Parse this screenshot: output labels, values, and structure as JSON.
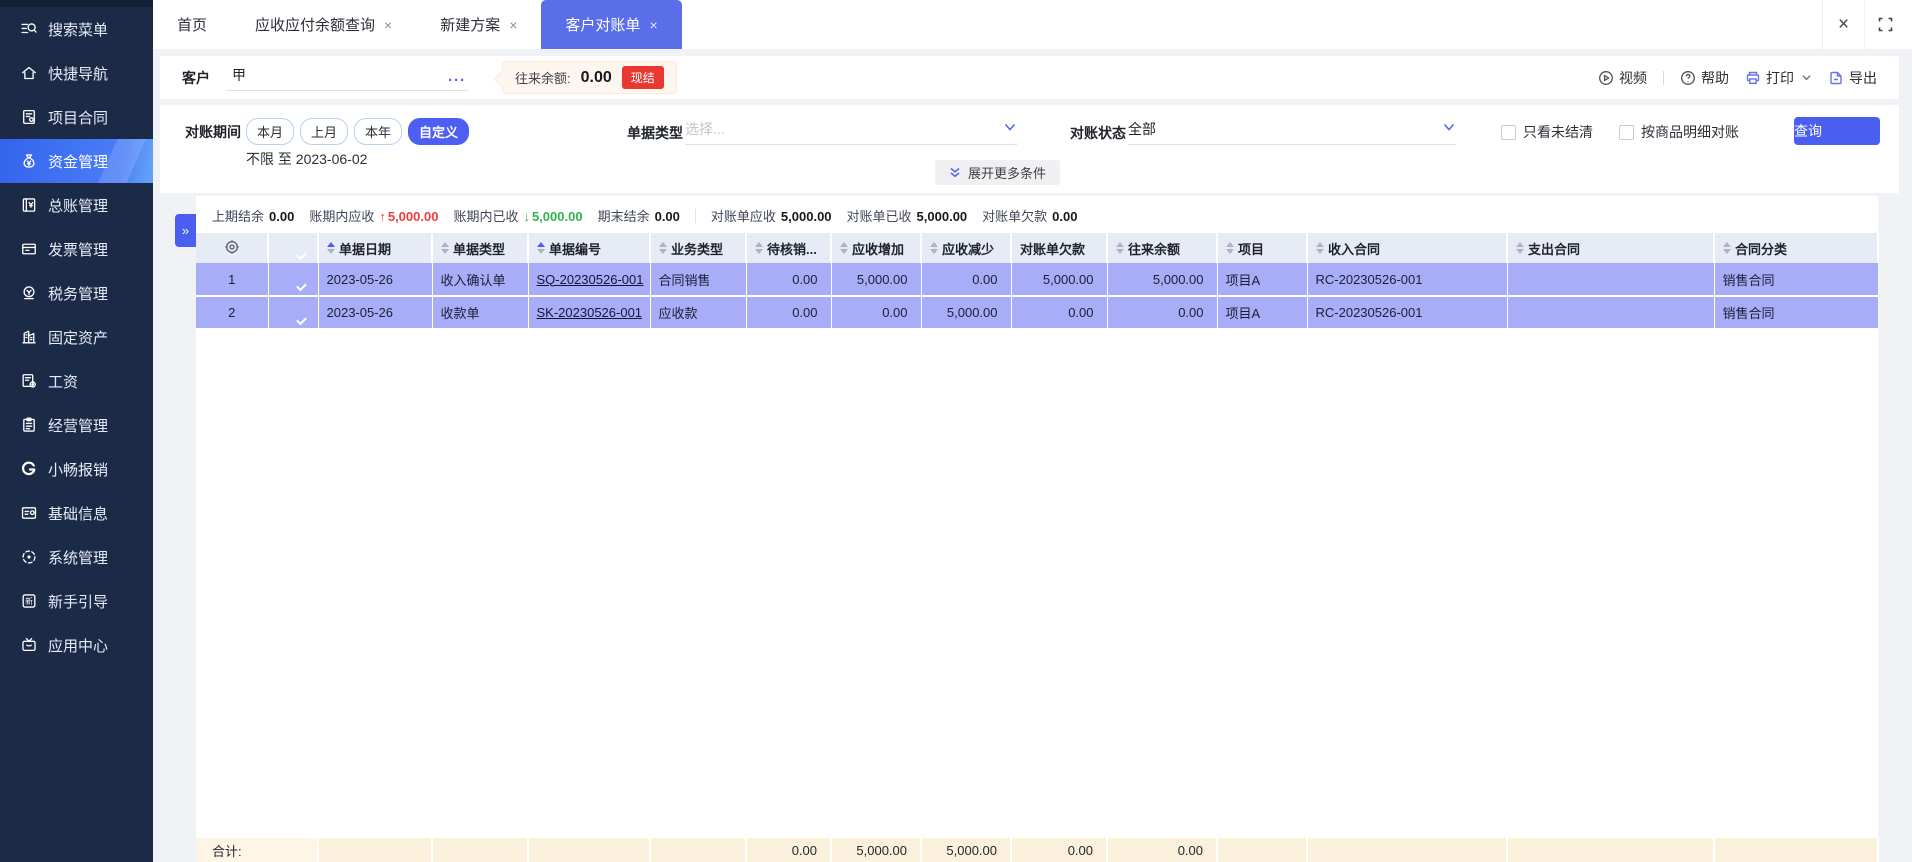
{
  "colors": {
    "accent": "#4d5ef2",
    "tab_active": "#5a6ee8",
    "sidebar_bg": "#1b2a47",
    "row_highlight": "#a8adf7",
    "table_header_bg": "#e7ebf6",
    "totals_bg": "#fbf0dc",
    "red": "#e8382f",
    "green": "#2fb54d",
    "page_bg": "#f0f2f5"
  },
  "sidebar": {
    "items": [
      {
        "label": "搜索菜单",
        "icon": "search-menu-icon"
      },
      {
        "label": "快捷导航",
        "icon": "home-icon"
      },
      {
        "label": "项目合同",
        "icon": "project-contract-icon"
      },
      {
        "label": "资金管理",
        "icon": "money-bag-icon",
        "active": true
      },
      {
        "label": "总账管理",
        "icon": "ledger-icon"
      },
      {
        "label": "发票管理",
        "icon": "invoice-icon"
      },
      {
        "label": "税务管理",
        "icon": "tax-icon"
      },
      {
        "label": "固定资产",
        "icon": "building-icon"
      },
      {
        "label": "工资",
        "icon": "salary-icon"
      },
      {
        "label": "经营管理",
        "icon": "clipboard-icon"
      },
      {
        "label": "小畅报销",
        "icon": "g-logo-icon"
      },
      {
        "label": "基础信息",
        "icon": "id-card-icon"
      },
      {
        "label": "系统管理",
        "icon": "system-icon"
      },
      {
        "label": "新手引导",
        "icon": "guide-icon"
      },
      {
        "label": "应用中心",
        "icon": "app-center-icon"
      }
    ]
  },
  "tabs": {
    "items": [
      {
        "label": "首页",
        "closable": false
      },
      {
        "label": "应收应付余额查询",
        "closable": true
      },
      {
        "label": "新建方案",
        "closable": true
      },
      {
        "label": "客户对账单",
        "closable": true,
        "active": true
      }
    ],
    "close_glyph": "×"
  },
  "toolbar": {
    "video": "视频",
    "help": "帮助",
    "print": "打印",
    "export": "导出"
  },
  "customer": {
    "label": "客户",
    "value": "甲",
    "more": "···"
  },
  "balance": {
    "label": "往来余额:",
    "value": "0.00",
    "badge": "现结"
  },
  "filters": {
    "period": {
      "label": "对账期间",
      "options": [
        "本月",
        "上月",
        "本年",
        "自定义"
      ],
      "selected": "自定义",
      "range": "不限 至 2023-06-02"
    },
    "doc_type": {
      "label": "单据类型",
      "placeholder": "选择..."
    },
    "status": {
      "label": "对账状态",
      "value": "全部"
    },
    "only_unsettled": "只看未结清",
    "by_product_detail": "按商品明细对账",
    "query": "查询",
    "expand_more": "展开更多条件"
  },
  "stats": {
    "prev_balance_label": "上期结余",
    "prev_balance": "0.00",
    "period_receivable_label": "账期内应收",
    "period_receivable": "5,000.00",
    "period_received_label": "账期内已收",
    "period_received": "5,000.00",
    "ending_balance_label": "期末结余",
    "ending_balance": "0.00",
    "stmt_receivable_label": "对账单应收",
    "stmt_receivable": "5,000.00",
    "stmt_received_label": "对账单已收",
    "stmt_received": "5,000.00",
    "stmt_debt_label": "对账单欠款",
    "stmt_debt": "0.00"
  },
  "table": {
    "columns": {
      "date": "单据日期",
      "doc_type": "单据类型",
      "doc_no": "单据编号",
      "biz_type": "业务类型",
      "pending": "待核销...",
      "ar_increase": "应收增加",
      "ar_decrease": "应收减少",
      "stmt_debt": "对账单欠款",
      "balance": "往来余额",
      "project": "项目",
      "income_contract": "收入合同",
      "expense_contract": "支出合同",
      "contract_class": "合同分类"
    },
    "rows": [
      {
        "index": "1",
        "date": "2023-05-26",
        "doc_type": "收入确认单",
        "doc_no": "SQ-20230526-001",
        "biz_type": "合同销售",
        "pending": "0.00",
        "ar_increase": "5,000.00",
        "ar_decrease": "0.00",
        "stmt_debt": "5,000.00",
        "balance": "5,000.00",
        "project": "项目A",
        "income_contract": "RC-20230526-001",
        "expense_contract": "",
        "contract_class": "销售合同"
      },
      {
        "index": "2",
        "date": "2023-05-26",
        "doc_type": "收款单",
        "doc_no": "SK-20230526-001",
        "biz_type": "应收款",
        "pending": "0.00",
        "ar_increase": "0.00",
        "ar_decrease": "5,000.00",
        "stmt_debt": "0.00",
        "balance": "0.00",
        "project": "项目A",
        "income_contract": "RC-20230526-001",
        "expense_contract": "",
        "contract_class": "销售合同"
      }
    ],
    "totals": {
      "label": "合计:",
      "pending": "0.00",
      "ar_increase": "5,000.00",
      "ar_decrease": "5,000.00",
      "stmt_debt": "0.00",
      "balance": "0.00"
    }
  }
}
